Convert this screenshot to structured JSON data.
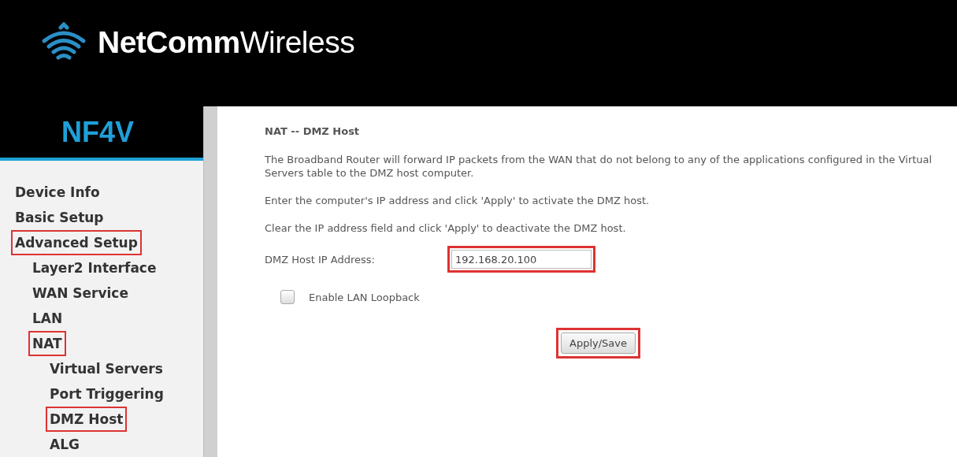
{
  "header": {
    "brand_bold": "NetComm",
    "brand_light": "Wireless"
  },
  "sidebar": {
    "model": "NF4V",
    "items": [
      {
        "label": "Device Info",
        "highlighted": false
      },
      {
        "label": "Basic Setup",
        "highlighted": false
      },
      {
        "label": "Advanced Setup",
        "highlighted": true,
        "children": [
          {
            "label": "Layer2 Interface",
            "highlighted": false
          },
          {
            "label": "WAN Service",
            "highlighted": false
          },
          {
            "label": "LAN",
            "highlighted": false
          },
          {
            "label": "NAT",
            "highlighted": true,
            "children": [
              {
                "label": "Virtual Servers",
                "highlighted": false
              },
              {
                "label": "Port Triggering",
                "highlighted": false
              },
              {
                "label": "DMZ Host",
                "highlighted": true
              },
              {
                "label": "ALG",
                "highlighted": false
              }
            ]
          }
        ]
      }
    ]
  },
  "content": {
    "title": "NAT -- DMZ Host",
    "paragraphs": [
      "The Broadband Router will forward IP packets from the WAN that do not belong to any of the applications configured in the Virtual Servers table to the DMZ host computer.",
      "Enter the computer's IP address and click 'Apply' to activate the DMZ host.",
      "Clear the IP address field and click 'Apply' to deactivate the DMZ host."
    ],
    "ip_field": {
      "label": "DMZ Host IP Address:",
      "value": "192.168.20.100",
      "highlighted": true
    },
    "loopback": {
      "label": "Enable LAN Loopback",
      "checked": false
    },
    "apply_button": {
      "label": "Apply/Save",
      "highlighted": true
    }
  }
}
